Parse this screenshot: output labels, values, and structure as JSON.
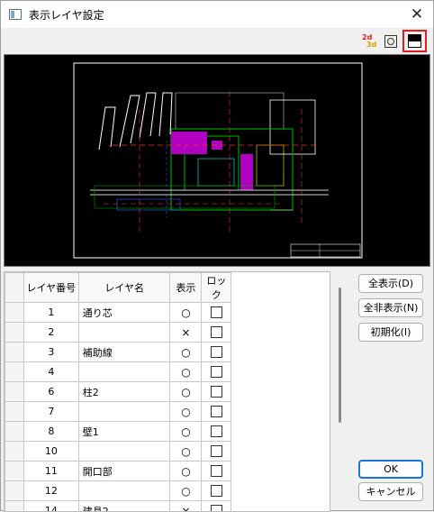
{
  "window": {
    "title": "表示レイヤ設定",
    "close_glyph": "✕"
  },
  "toolbar": {
    "mode_icon": "2d-3d-icon",
    "mode_icon_top": "2d",
    "mode_icon_bottom": "3d",
    "fit_icon": "zoom-fit-icon",
    "background_icon": "background-color-icon"
  },
  "preview": {
    "background": "#000000"
  },
  "table": {
    "headers": {
      "number": "レイヤ番号",
      "name": "レイヤ名",
      "visible": "表示",
      "lock": "ロック"
    },
    "rows": [
      {
        "number": "1",
        "name": "通り芯",
        "visible": "○",
        "locked": false
      },
      {
        "number": "2",
        "name": "",
        "visible": "×",
        "locked": false
      },
      {
        "number": "3",
        "name": "補助線",
        "visible": "○",
        "locked": false
      },
      {
        "number": "4",
        "name": "",
        "visible": "○",
        "locked": false
      },
      {
        "number": "6",
        "name": "柱2",
        "visible": "○",
        "locked": false
      },
      {
        "number": "7",
        "name": "",
        "visible": "○",
        "locked": false
      },
      {
        "number": "8",
        "name": "壁1",
        "visible": "○",
        "locked": false
      },
      {
        "number": "10",
        "name": "",
        "visible": "○",
        "locked": false
      },
      {
        "number": "11",
        "name": "開口部",
        "visible": "○",
        "locked": false
      },
      {
        "number": "12",
        "name": "",
        "visible": "○",
        "locked": false
      },
      {
        "number": "14",
        "name": "建具2",
        "visible": "×",
        "locked": false
      }
    ]
  },
  "buttons": {
    "show_all": "全表示(D)",
    "hide_all": "全非表示(N)",
    "reset": "初期化(I)",
    "ok": "OK",
    "cancel": "キャンセル"
  }
}
